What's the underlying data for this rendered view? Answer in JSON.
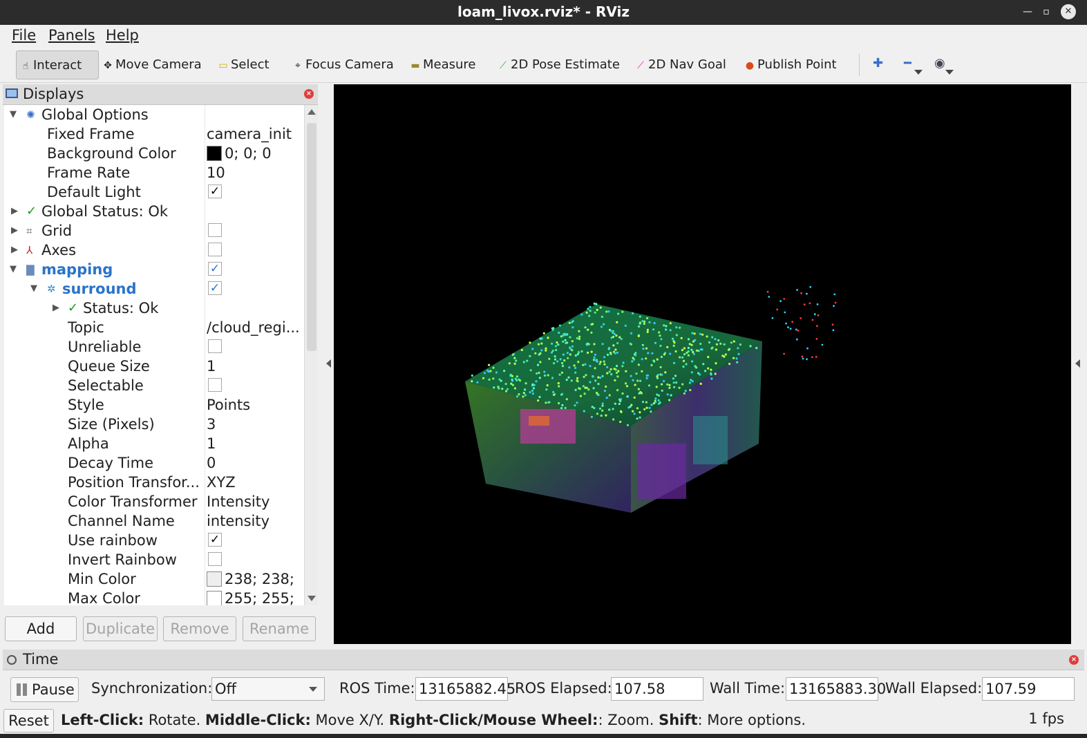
{
  "window": {
    "title": "loam_livox.rviz* - RViz"
  },
  "menu": {
    "items": [
      {
        "label": "File"
      },
      {
        "label": "Panels"
      },
      {
        "label": "Help"
      }
    ]
  },
  "toolbar": {
    "tools": [
      {
        "label": "Interact",
        "icon": "hand-pointer-icon",
        "active": true
      },
      {
        "label": "Move Camera",
        "icon": "move-arrows-icon"
      },
      {
        "label": "Select",
        "icon": "select-rect-icon"
      },
      {
        "label": "Focus Camera",
        "icon": "crosshair-icon"
      },
      {
        "label": "Measure",
        "icon": "ruler-icon"
      },
      {
        "label": "2D Pose Estimate",
        "icon": "green-arrow-icon"
      },
      {
        "label": "2D Nav Goal",
        "icon": "magenta-arrow-icon"
      },
      {
        "label": "Publish Point",
        "icon": "map-pin-icon"
      }
    ],
    "extras": [
      "plus-icon",
      "minus-icon",
      "eye-icon"
    ]
  },
  "displays": {
    "title": "Displays",
    "rows": [
      {
        "name": "Global Options",
        "value": ""
      },
      {
        "name": "Fixed Frame",
        "value": "camera_init"
      },
      {
        "name": "Background Color",
        "value": "0; 0; 0",
        "swatch": "#000000"
      },
      {
        "name": "Frame Rate",
        "value": "10"
      },
      {
        "name": "Default Light",
        "checked": true
      },
      {
        "name": "Global Status: Ok",
        "value": ""
      },
      {
        "name": "Grid",
        "checked": false
      },
      {
        "name": "Axes",
        "checked": false
      },
      {
        "name": "mapping",
        "checked": true
      },
      {
        "name": "surround",
        "checked": true
      },
      {
        "name": "Status: Ok",
        "value": ""
      },
      {
        "name": "Topic",
        "value": "/cloud_regi..."
      },
      {
        "name": "Unreliable",
        "checked": false
      },
      {
        "name": "Queue Size",
        "value": "1"
      },
      {
        "name": "Selectable",
        "checked": false
      },
      {
        "name": "Style",
        "value": "Points"
      },
      {
        "name": "Size (Pixels)",
        "value": "3"
      },
      {
        "name": "Alpha",
        "value": "1"
      },
      {
        "name": "Decay Time",
        "value": "0"
      },
      {
        "name": "Position Transfor...",
        "value": "XYZ"
      },
      {
        "name": "Color Transformer",
        "value": "Intensity"
      },
      {
        "name": "Channel Name",
        "value": "intensity"
      },
      {
        "name": "Use rainbow",
        "checked": true
      },
      {
        "name": "Invert Rainbow",
        "checked": false
      },
      {
        "name": "Min Color",
        "value": "238; 238;",
        "swatch": "#eeeeee"
      },
      {
        "name": "Max Color",
        "value": "255; 255;",
        "swatch": "#ffffff"
      }
    ],
    "buttons": {
      "add": "Add",
      "duplicate": "Duplicate",
      "remove": "Remove",
      "rename": "Rename"
    }
  },
  "time": {
    "title": "Time",
    "pause_label": "Pause",
    "sync_label": "Synchronization:",
    "sync_value": "Off",
    "ros_time_label": "ROS Time:",
    "ros_time": "13165882.45",
    "ros_elapsed_label": "ROS Elapsed:",
    "ros_elapsed": "107.58",
    "wall_time_label": "Wall Time:",
    "wall_time": "13165883.30",
    "wall_elapsed_label": "Wall Elapsed:",
    "wall_elapsed": "107.59"
  },
  "status": {
    "reset_label": "Reset",
    "left_click": "Left-Click:",
    "left_action": " Rotate. ",
    "middle_click": "Middle-Click:",
    "middle_action": " Move X/Y. ",
    "right_click": "Right-Click/Mouse Wheel:",
    "right_action": ": Zoom. ",
    "shift": "Shift",
    "shift_action": ": More options.",
    "fps": "1 fps"
  },
  "colors": {
    "viewport_bg": "#000000",
    "accent": "#2a73c9"
  }
}
